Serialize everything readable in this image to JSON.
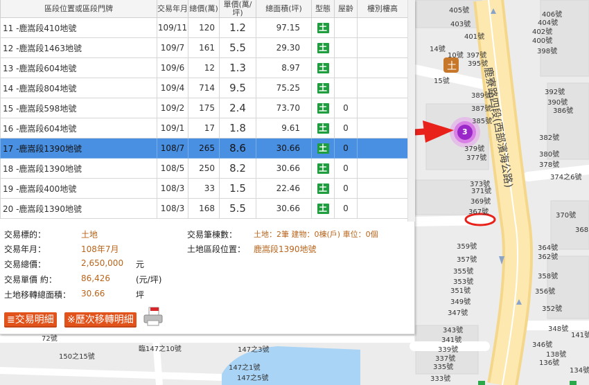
{
  "table": {
    "headers": [
      "區段位置或區段門牌",
      "交易年月",
      "總價(萬)",
      "單價(萬/坪)",
      "總面積(坪)",
      "型態",
      "屋齡",
      "樓別樓高"
    ],
    "rows": [
      {
        "addr": "11 -鹿嵩段410地號",
        "date": "109/11",
        "total": "120",
        "unit": "1.2",
        "area": "97.15",
        "type": "土",
        "age": ""
      },
      {
        "addr": "12 -鹿嵩段1463地號",
        "date": "109/7",
        "total": "161",
        "unit": "5.5",
        "area": "29.30",
        "type": "土",
        "age": ""
      },
      {
        "addr": "13 -鹿嵩段604地號",
        "date": "109/6",
        "total": "12",
        "unit": "1.3",
        "area": "8.97",
        "type": "土",
        "age": ""
      },
      {
        "addr": "14 -鹿嵩段804地號",
        "date": "109/4",
        "total": "714",
        "unit": "9.5",
        "area": "75.25",
        "type": "土",
        "age": ""
      },
      {
        "addr": "15 -鹿嵩段598地號",
        "date": "109/2",
        "total": "175",
        "unit": "2.4",
        "area": "73.70",
        "type": "土",
        "age": "0"
      },
      {
        "addr": "16 -鹿嵩段604地號",
        "date": "109/1",
        "total": "17",
        "unit": "1.8",
        "area": "9.61",
        "type": "土",
        "age": "0"
      },
      {
        "addr": "17 -鹿嵩段1390地號",
        "date": "108/7",
        "total": "265",
        "unit": "8.6",
        "area": "30.66",
        "type": "土",
        "age": "0"
      },
      {
        "addr": "18 -鹿嵩段1390地號",
        "date": "108/5",
        "total": "250",
        "unit": "8.2",
        "area": "30.66",
        "type": "土",
        "age": "0"
      },
      {
        "addr": "19 -鹿嵩段400地號",
        "date": "108/3",
        "total": "33",
        "unit": "1.5",
        "area": "22.46",
        "type": "土",
        "age": "0"
      },
      {
        "addr": "20 -鹿嵩段1390地號",
        "date": "108/3",
        "total": "168",
        "unit": "5.5",
        "area": "30.66",
        "type": "土",
        "age": "0"
      }
    ],
    "selected_index": 6
  },
  "detail": {
    "target_label": "交易標的：",
    "target_value": "土地",
    "date_label": "交易年月：",
    "date_value": "108年7月",
    "total_label": "交易總價：",
    "total_value": "2,650,000",
    "total_unit": "元",
    "unit_label": "交易單價 約：",
    "unit_value": "86,426",
    "unit_unit": "(元/坪)",
    "area_label": "土地移轉總面積：",
    "area_value": "30.66",
    "area_unit": "坪",
    "count_label": "交易筆棟數：",
    "count_value": "土地：2筆 建物：0棟(戶) 車位：0個",
    "location_label": "土地區段位置：",
    "location_value": "鹿嵩段1390地號",
    "btn_detail": "≣交易明細",
    "btn_history": "※歷次移轉明細"
  },
  "map": {
    "road_name": "鹿寮路四段(西部濱海公路)",
    "cluster_count": "3",
    "shop_glyph": "土",
    "labels": [
      "405號",
      "403號",
      "401號",
      "397號",
      "395號",
      "14號",
      "10號",
      "15號",
      "389號",
      "387號",
      "385號",
      "379號",
      "377號",
      "373號",
      "371號",
      "369號",
      "367號",
      "359號",
      "357號",
      "355號",
      "353號",
      "351號",
      "349號",
      "347號",
      "343號",
      "341號",
      "339號",
      "337號",
      "335號",
      "333號",
      "406號",
      "404號",
      "402號",
      "400號",
      "398號",
      "392號",
      "390號",
      "386號",
      "382號",
      "380號",
      "378號",
      "374之6號",
      "370號",
      "368",
      "364號",
      "362號",
      "358號",
      "356號",
      "352號",
      "348號",
      "346號",
      "141號",
      "138號",
      "136號",
      "134號",
      "臨147之10號",
      "147之3號",
      "147之1號",
      "147之5號",
      "150之15號",
      "72號"
    ]
  },
  "colors": {
    "selected_row": "#4a90e2",
    "land_badge": "#1e9e3e",
    "value_text": "#b8641b",
    "button": "#e2531c",
    "arrow": "#e8211b",
    "cluster": "#b12fd6"
  }
}
